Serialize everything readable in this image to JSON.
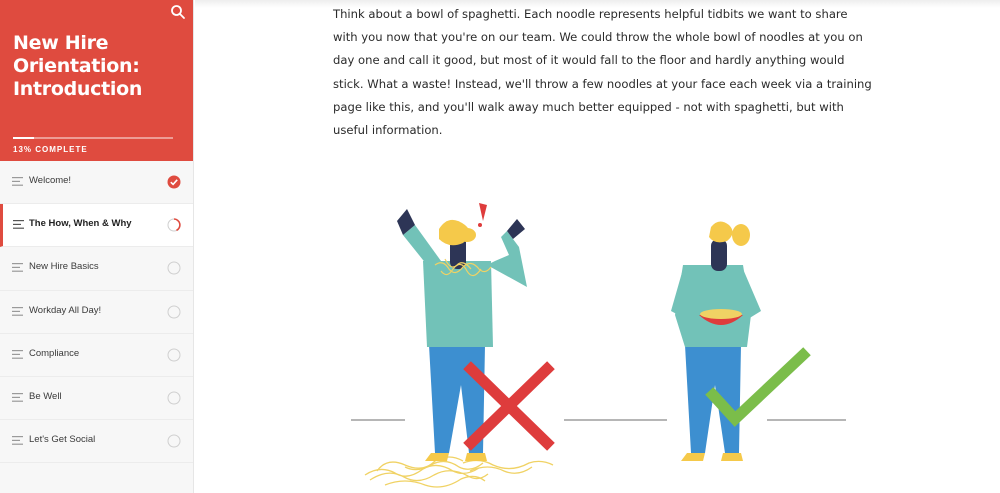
{
  "course": {
    "title": "New Hire Orientation: Introduction",
    "progress_text": "13% COMPLETE",
    "progress_percent": 13
  },
  "search": {
    "icon": "search-icon"
  },
  "lessons": [
    {
      "label": "Welcome!",
      "status": "complete"
    },
    {
      "label": "The How, When & Why",
      "status": "in-progress"
    },
    {
      "label": "New Hire Basics",
      "status": "not-started"
    },
    {
      "label": "Workday All Day!",
      "status": "not-started"
    },
    {
      "label": "Compliance",
      "status": "not-started"
    },
    {
      "label": "Be Well",
      "status": "not-started"
    },
    {
      "label": "Let's Get Social",
      "status": "not-started"
    }
  ],
  "main": {
    "paragraph": "Think about a bowl of spaghetti. Each noodle represents helpful tidbits we want to share with you now that you're on our team. We could throw the whole bowl of noodles at you on day one and call it good, but most of it would fall to the floor and hardly anything would stick. What a waste! Instead, we'll throw a few noodles at your face each week via a training page like this, and you'll walk away much better equipped - not with spaghetti, but with useful information."
  },
  "colors": {
    "brand_red": "#df4b3f",
    "teal_shirt": "#72c2b8",
    "blue_pants": "#3d8fd0",
    "hair_yellow": "#f5c94a",
    "check_green": "#7bbd4a",
    "x_red": "#de3c3c"
  }
}
